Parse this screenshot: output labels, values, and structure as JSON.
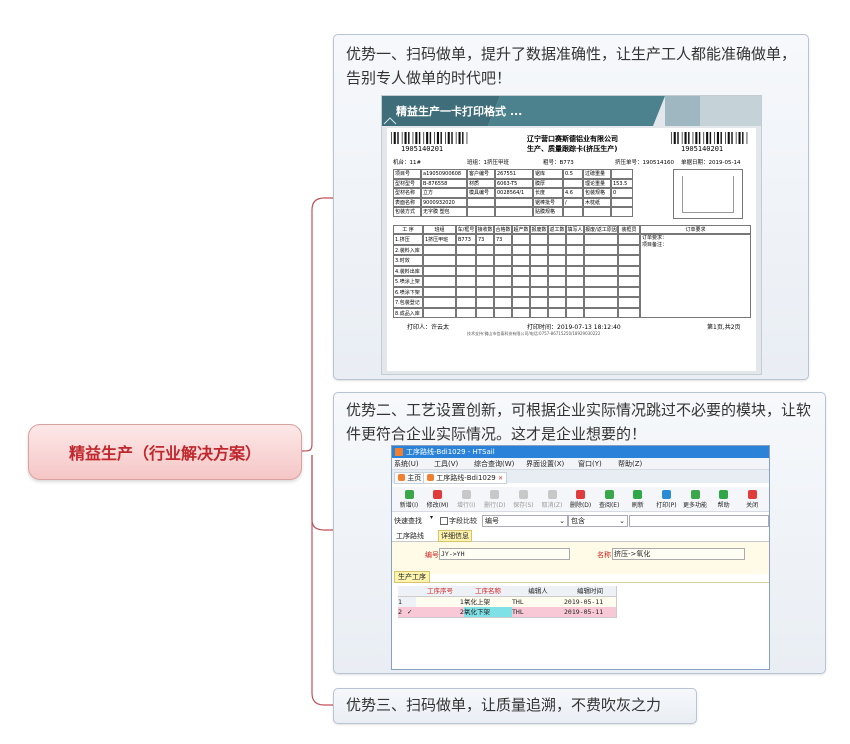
{
  "mindmap": {
    "root": "精益生产（行业解决方案）",
    "topics": [
      {
        "text": "优势一、扫码做单，提升了数据准确性，让生产工人都能准确做单，告别专人做单的时代吧！"
      },
      {
        "text": "优势二、工艺设置创新，可根据企业实际情况跳过不必要的模块，让软件更符合企业实际情况。这才是企业想要的！"
      },
      {
        "text": "优势三、扫码做单，让质量追溯，不费吹灰之力"
      }
    ]
  },
  "card": {
    "banner": "精益生产一卡打印格式 ...",
    "barcode_left": "1905140201",
    "barcode_right": "1905140201",
    "company": "辽宁营口赛斯德铝业有限公司",
    "subtitle": "生产、质量跟踪卡(挤压生产)",
    "header_fields": [
      "机台：11#",
      "班组：1挤压甲班",
      "粗号：B773",
      "挤压单号：190514160",
      "单据日期：2019-05-14"
    ],
    "info_rows": [
      [
        "项目号",
        "a19050900608",
        "客户编号",
        "267551",
        "锯库",
        "0.5",
        "过磅重量",
        ""
      ],
      [
        "型材型号",
        "B-876558",
        "材质",
        "6063-T5",
        "膜厚",
        "",
        "理论重量",
        "153.5"
      ],
      [
        "型材名称",
        "立方",
        "模具编号",
        "0028564/1",
        "长度",
        "4.6",
        "包装规格",
        "0"
      ],
      [
        "表面名称",
        "9000932020",
        "",
        "",
        "锯棒批号",
        "/",
        "木枕纸",
        ""
      ],
      [
        "包装方式",
        "无字膜 塑包",
        "",
        "",
        "贴膜规格",
        "",
        "",
        ""
      ]
    ],
    "proc_headers": [
      "工 序",
      "班组",
      "车/框号",
      "接收数",
      "合格数",
      "超产数",
      "报废数",
      "返工数",
      "填写人",
      "报废/返工原因",
      "装框员",
      "订单要求"
    ],
    "proc_rows": [
      [
        "1.挤压",
        "1挤压甲班",
        "B773",
        "73",
        "73"
      ],
      [
        "2.装料入库",
        "",
        "",
        "",
        ""
      ],
      [
        "3.时效",
        "",
        "",
        "",
        ""
      ],
      [
        "4.装料出库",
        "",
        "",
        "",
        ""
      ],
      [
        "5.喷涂上架",
        "",
        "",
        "",
        ""
      ],
      [
        "6.喷涂下架",
        "",
        "",
        "",
        ""
      ],
      [
        "7.包装登记",
        "",
        "",
        "",
        ""
      ],
      [
        "8.成品入库",
        "",
        "",
        "",
        ""
      ]
    ],
    "order_notes": [
      "订单要求：",
      "项目备注："
    ],
    "printer": "打印人：许云太",
    "print_time": "打印时间：2019-07-13  18:12:40",
    "page": "第1页,共2页",
    "support": "技术支持:佛山市信泰科技有限公司/电话:0757-86715250/18929030222"
  },
  "window": {
    "title": "工序路线-Bdi1029 - HTSail",
    "menu": [
      "系统(U)",
      "工具(V)",
      "综合查询(W)",
      "界面设置(X)",
      "窗口(Y)",
      "帮助(Z)"
    ],
    "tabs": [
      "主页",
      "工序路线-Bdi1029"
    ],
    "toolbar": [
      {
        "label": "新增(I)",
        "color": "#3aa84a"
      },
      {
        "label": "修改(M)",
        "color": "#e03c3c"
      },
      {
        "label": "增行(I)",
        "color": "#c8c8c8"
      },
      {
        "label": "删行(D)",
        "color": "#c8c8c8"
      },
      {
        "label": "保存(S)",
        "color": "#c8c8c8"
      },
      {
        "label": "取消(Z)",
        "color": "#c8c8c8"
      },
      {
        "label": "删除(D)",
        "color": "#e03c3c"
      },
      {
        "label": "查阅(E)",
        "color": "#3aa84a"
      },
      {
        "label": "刷新",
        "color": "#2fa84a"
      },
      {
        "label": "打印(P)",
        "color": "#2a8ad4"
      },
      {
        "label": "更多功能",
        "color": "#3aa84a"
      },
      {
        "label": "帮助",
        "color": "#2fa84a"
      },
      {
        "label": "关闭",
        "color": "#e03c3c"
      }
    ],
    "quick_search": "快速查找",
    "word_compare": "字段比较",
    "field_select": "编号",
    "match_select": "包含",
    "sub_tabs": [
      "工序路线",
      "详细信息"
    ],
    "code_label": "编号",
    "code_value": "JY->YH",
    "name_label": "名称",
    "name_value": "挤压->氧化",
    "section": "生产工序",
    "grid_headers": [
      "工序序号",
      "工序名称",
      "编辑人",
      "编辑时间"
    ],
    "grid_rows": [
      {
        "idx": "1",
        "mark": "",
        "seq": "1",
        "name": "氧化上架",
        "editor": "THL",
        "time": "2019-05-11"
      },
      {
        "idx": "2",
        "mark": "✓",
        "seq": "2",
        "name": "氧化下架",
        "editor": "THL",
        "time": "2019-05-11"
      }
    ]
  }
}
